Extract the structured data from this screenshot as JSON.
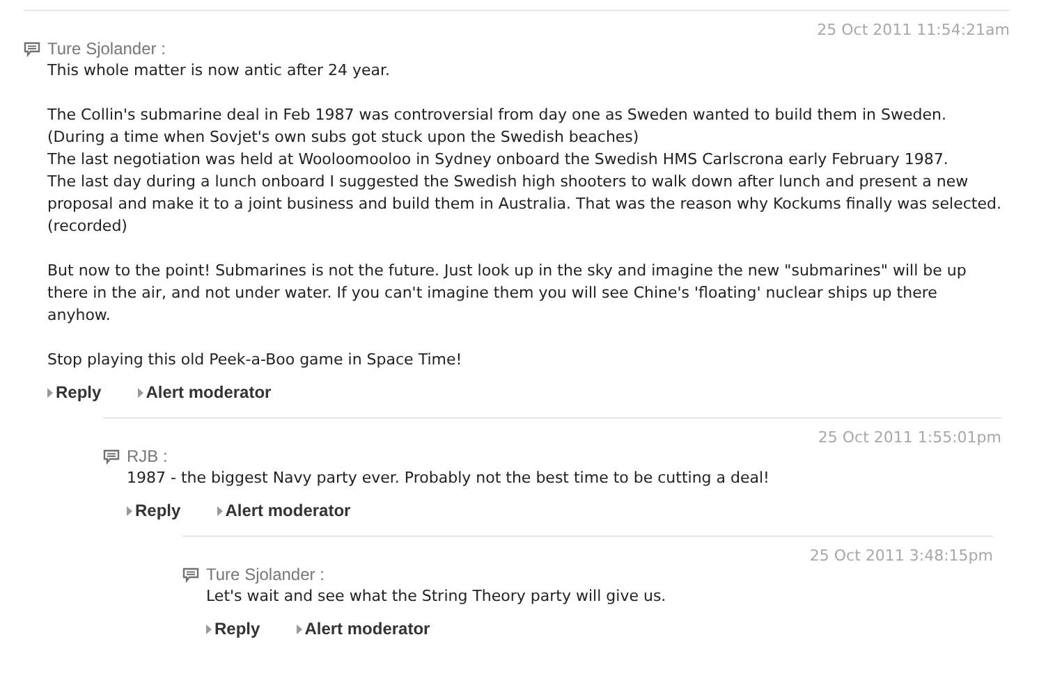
{
  "comments": [
    {
      "author": "Ture Sjolander :",
      "timestamp": "25 Oct 2011 11:54:21am",
      "paragraphs": [
        [
          "This whole matter is now antic after 24 year."
        ],
        [
          "The Collin's submarine deal in Feb 1987 was controversial from day one as Sweden wanted to build them in Sweden.",
          "(During a time when Sovjet's own subs got stuck upon the Swedish beaches)",
          "The last negotiation was held at Wooloomooloo in Sydney onboard the Swedish HMS Carlscrona early February 1987.",
          "The last day during a lunch onboard I suggested the Swedish high shooters to walk down after lunch and present a new proposal and make it to a joint business and build them in Australia. That was the reason why Kockums finally was selected.(recorded)"
        ],
        [
          "But now to the point! Submarines is not the future. Just look up in the sky and imagine the new \"submarines\" will be up there in the air, and not under water. If you can't imagine them you will see Chine's 'floating' nuclear ships up there anyhow."
        ],
        [
          "Stop playing this old Peek-a-Boo game in Space Time!"
        ]
      ],
      "actions": [
        "Reply",
        "Alert moderator"
      ],
      "children": [
        {
          "author": "RJB :",
          "timestamp": "25 Oct 2011 1:55:01pm",
          "paragraphs": [
            [
              "1987 - the biggest Navy party ever. Probably not the best time to be cutting a deal!"
            ]
          ],
          "actions": [
            "Reply",
            "Alert moderator"
          ],
          "children": [
            {
              "author": "Ture Sjolander :",
              "timestamp": "25 Oct 2011 3:48:15pm",
              "paragraphs": [
                [
                  "Let's wait and see what the String Theory party will give us."
                ]
              ],
              "actions": [
                "Reply",
                "Alert moderator"
              ]
            }
          ]
        }
      ]
    }
  ]
}
